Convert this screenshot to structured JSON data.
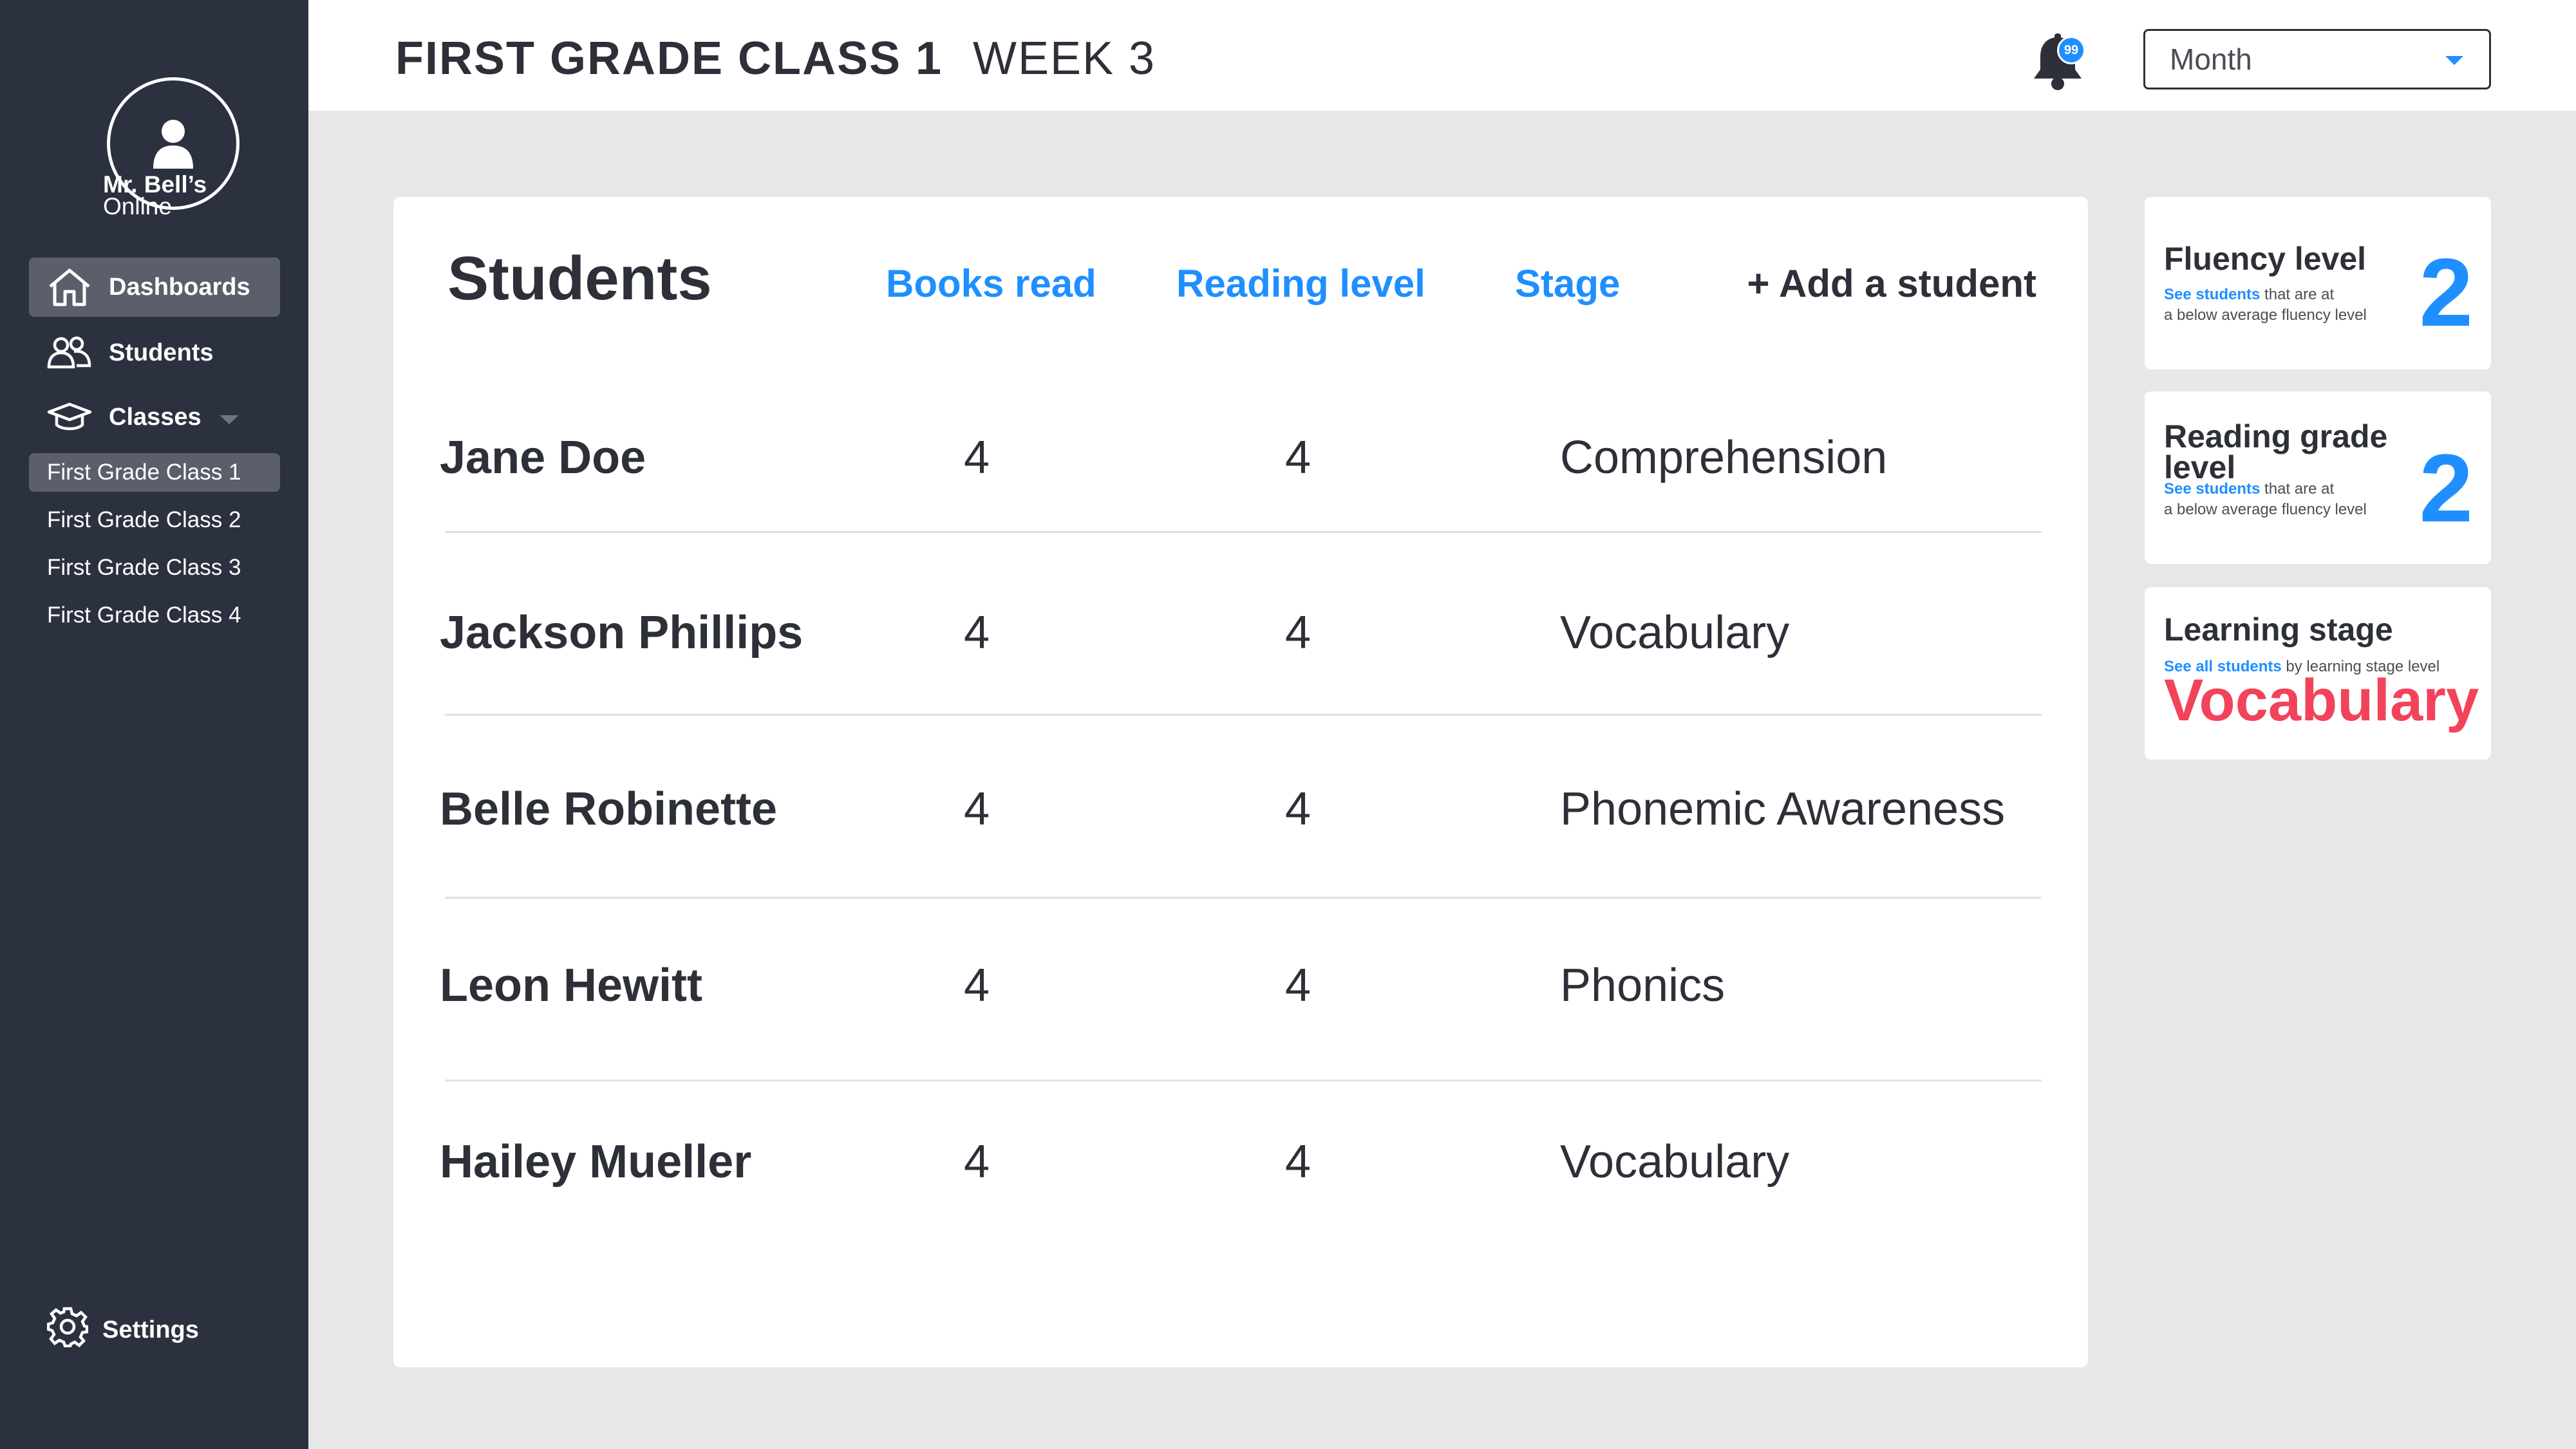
{
  "sidebar": {
    "brand_line1": "Mr. Bell’s",
    "brand_line2": "Online",
    "nav": [
      {
        "label": "Dashboards",
        "icon": "home-icon"
      },
      {
        "label": "Students",
        "icon": "students-icon"
      },
      {
        "label": "Classes",
        "icon": "graduation-cap-icon"
      }
    ],
    "classes": [
      "First Grade Class 1",
      "First Grade Class 2",
      "First Grade Class 3",
      "First Grade Class 4"
    ],
    "settings_label": "Settings"
  },
  "header": {
    "class_title": "FIRST GRADE CLASS 1",
    "week_title": "WEEK 3",
    "notification_count": "99",
    "period_select": "Month"
  },
  "students_panel": {
    "title": "Students",
    "columns": [
      "Books read",
      "Reading level",
      "Stage"
    ],
    "add_label": "+ Add a student",
    "rows": [
      {
        "name": "Jane Doe",
        "books": "4",
        "level": "4",
        "stage": "Comprehension"
      },
      {
        "name": "Jackson Phillips",
        "books": "4",
        "level": "4",
        "stage": "Vocabulary"
      },
      {
        "name": "Belle Robinette",
        "books": "4",
        "level": "4",
        "stage": "Phonemic Awareness"
      },
      {
        "name": "Leon Hewitt",
        "books": "4",
        "level": "4",
        "stage": "Phonics"
      },
      {
        "name": "Hailey Mueller",
        "books": "4",
        "level": "4",
        "stage": "Vocabulary"
      }
    ]
  },
  "stats": {
    "fluency": {
      "title": "Fluency level",
      "link": "See students",
      "sub1": " that are at",
      "sub2": "a below average fluency level",
      "value": "2"
    },
    "reading_grade": {
      "title_line1": "Reading grade",
      "title_line2": "level",
      "link": "See students",
      "sub1": " that are at",
      "sub2": "a below average fluency level",
      "value": "2"
    },
    "learning_stage": {
      "title": "Learning stage",
      "link": "See all students",
      "sub1": " by learning stage level",
      "value": "Vocabulary"
    }
  },
  "colors": {
    "sidebar_bg": "#2c3140",
    "accent_blue": "#1f8fff",
    "accent_red": "#f2435a",
    "page_bg": "#e7e7e7"
  }
}
